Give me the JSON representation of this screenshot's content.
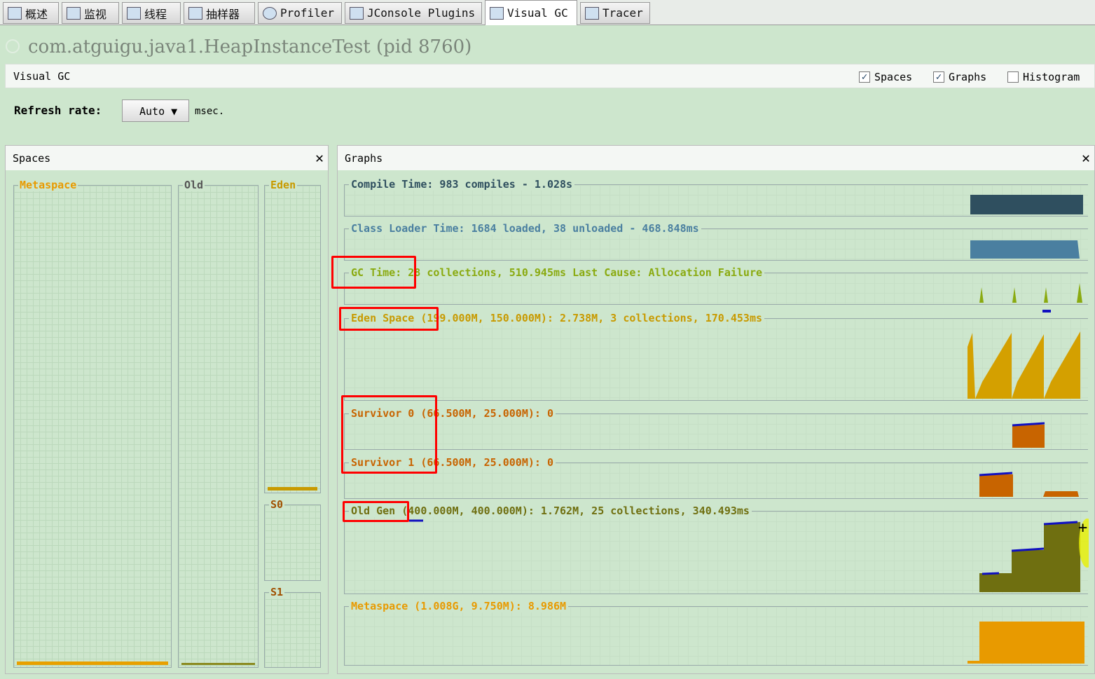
{
  "tabs": [
    {
      "label": "概述",
      "icon": "overview-icon"
    },
    {
      "label": "监视",
      "icon": "monitor-icon"
    },
    {
      "label": "线程",
      "icon": "threads-icon"
    },
    {
      "label": "抽样器",
      "icon": "sampler-icon"
    },
    {
      "label": "Profiler",
      "icon": "profiler-icon"
    },
    {
      "label": "JConsole Plugins",
      "icon": "jconsole-icon"
    },
    {
      "label": "Visual GC",
      "icon": "visualgc-icon",
      "active": true
    },
    {
      "label": "Tracer",
      "icon": "tracer-icon"
    }
  ],
  "app_title": "com.atguigu.java1.HeapInstanceTest (pid 8760)",
  "header": {
    "title": "Visual GC",
    "spaces": "Spaces",
    "graphs": "Graphs",
    "histogram": "Histogram",
    "spaces_checked": true,
    "graphs_checked": true,
    "histogram_checked": false
  },
  "refresh": {
    "label": "Refresh rate:",
    "value": "Auto",
    "unit": "msec."
  },
  "spaces_panel": {
    "title": "Spaces",
    "metaspace": "Metaspace",
    "old": "Old",
    "eden": "Eden",
    "s0": "S0",
    "s1": "S1"
  },
  "graphs_panel": {
    "title": "Graphs",
    "compile": "Compile Time: 983 compiles - 1.028s",
    "classloader": "Class Loader Time: 1684 loaded, 38 unloaded - 468.848ms",
    "gc": "GC Time: 28 collections, 510.945ms Last Cause: Allocation Failure",
    "eden": "Eden Space (199.000M, 150.000M): 2.738M, 3 collections, 170.453ms",
    "s0": "Survivor 0 (66.500M, 25.000M): 0",
    "s1": "Survivor 1 (66.500M, 25.000M): 0",
    "old": "Old Gen (400.000M, 400.000M): 1.762M, 25 collections, 340.493ms",
    "meta": "Metaspace (1.008G, 9.750M): 8.986M"
  },
  "colors": {
    "background": "#cde6cd",
    "compile": "#2f4f5f",
    "classloader": "#4a7fa0",
    "gc": "#8aaa10",
    "eden": "#d4a000",
    "survivor": "#c86400",
    "old": "#6f6f10",
    "metaspace": "#e89a00",
    "highlight": "#ff0000"
  }
}
